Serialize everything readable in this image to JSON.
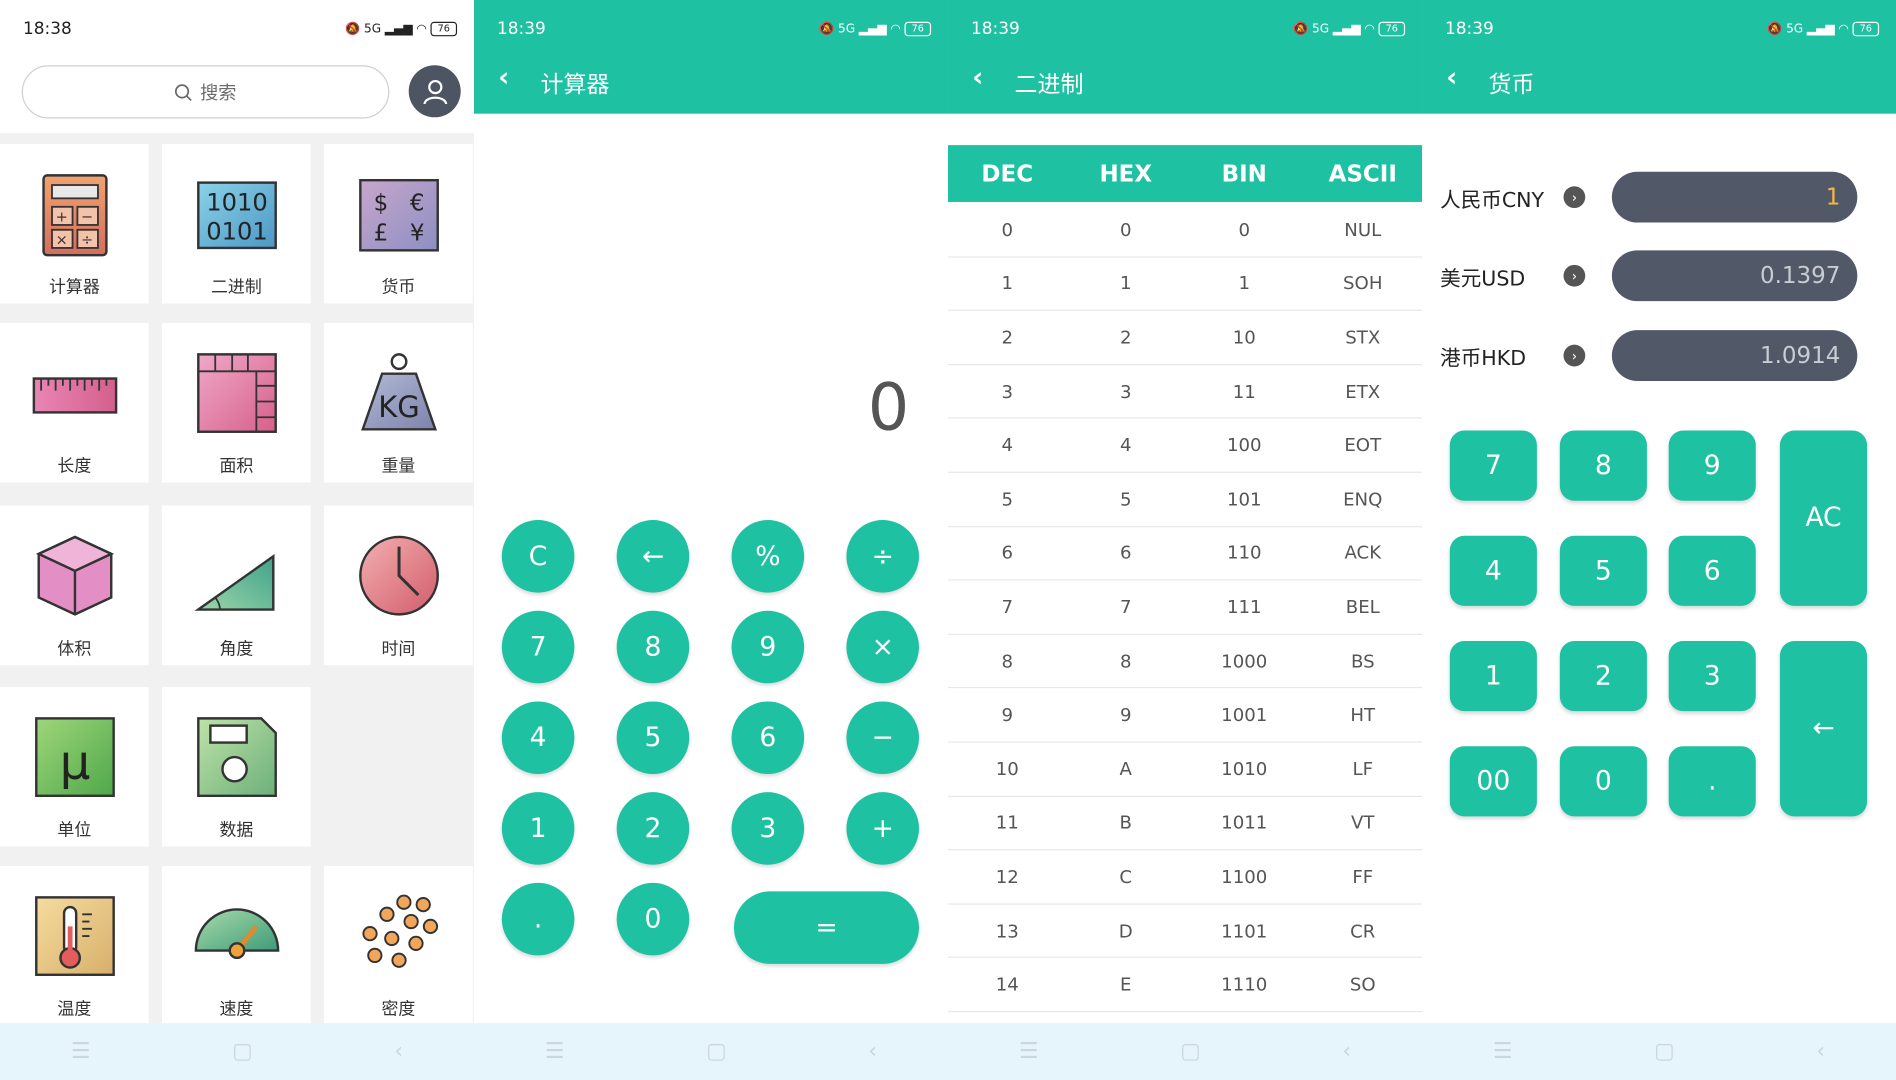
{
  "status": {
    "time1": "18:38",
    "time2": "18:39",
    "time3": "18:39",
    "time4": "18:39",
    "signal": "5G",
    "battery": "76"
  },
  "home": {
    "search_placeholder": "搜索",
    "tiles": [
      "计算器",
      "二进制",
      "货币",
      "长度",
      "面积",
      "重量",
      "体积",
      "角度",
      "时间",
      "单位",
      "数据",
      "温度",
      "速度",
      "密度"
    ],
    "binary_icon_text": [
      "1010",
      "0101"
    ],
    "currency_icon_text": [
      "$",
      "€",
      "£",
      "¥"
    ],
    "weight_icon_text": "KG",
    "unit_icon_text": "μ"
  },
  "calculator": {
    "title": "计算器",
    "display": "0",
    "buttons": [
      "C",
      "←",
      "%",
      "÷",
      "7",
      "8",
      "9",
      "×",
      "4",
      "5",
      "6",
      "−",
      "1",
      "2",
      "3",
      "+",
      ".",
      "0"
    ],
    "equals": "="
  },
  "binary": {
    "title": "二进制",
    "headers": [
      "DEC",
      "HEX",
      "BIN",
      "ASCII"
    ],
    "rows": [
      [
        "0",
        "0",
        "0",
        "NUL"
      ],
      [
        "1",
        "1",
        "1",
        "SOH"
      ],
      [
        "2",
        "2",
        "10",
        "STX"
      ],
      [
        "3",
        "3",
        "11",
        "ETX"
      ],
      [
        "4",
        "4",
        "100",
        "EOT"
      ],
      [
        "5",
        "5",
        "101",
        "ENQ"
      ],
      [
        "6",
        "6",
        "110",
        "ACK"
      ],
      [
        "7",
        "7",
        "111",
        "BEL"
      ],
      [
        "8",
        "8",
        "1000",
        "BS"
      ],
      [
        "9",
        "9",
        "1001",
        "HT"
      ],
      [
        "10",
        "A",
        "1010",
        "LF"
      ],
      [
        "11",
        "B",
        "1011",
        "VT"
      ],
      [
        "12",
        "C",
        "1100",
        "FF"
      ],
      [
        "13",
        "D",
        "1101",
        "CR"
      ],
      [
        "14",
        "E",
        "1110",
        "SO"
      ]
    ]
  },
  "currency": {
    "title": "货币",
    "rows": [
      {
        "label": "人民币CNY",
        "value": "1"
      },
      {
        "label": "美元USD",
        "value": "0.1397"
      },
      {
        "label": "港币HKD",
        "value": "1.0914"
      }
    ],
    "keys": [
      "7",
      "8",
      "9",
      "4",
      "5",
      "6",
      "1",
      "2",
      "3",
      "00",
      "0",
      "."
    ],
    "ac": "AC",
    "backspace": "←"
  },
  "colors": {
    "accent": "#1fc1a3",
    "field": "#515968",
    "active_value": "#f5b942"
  }
}
